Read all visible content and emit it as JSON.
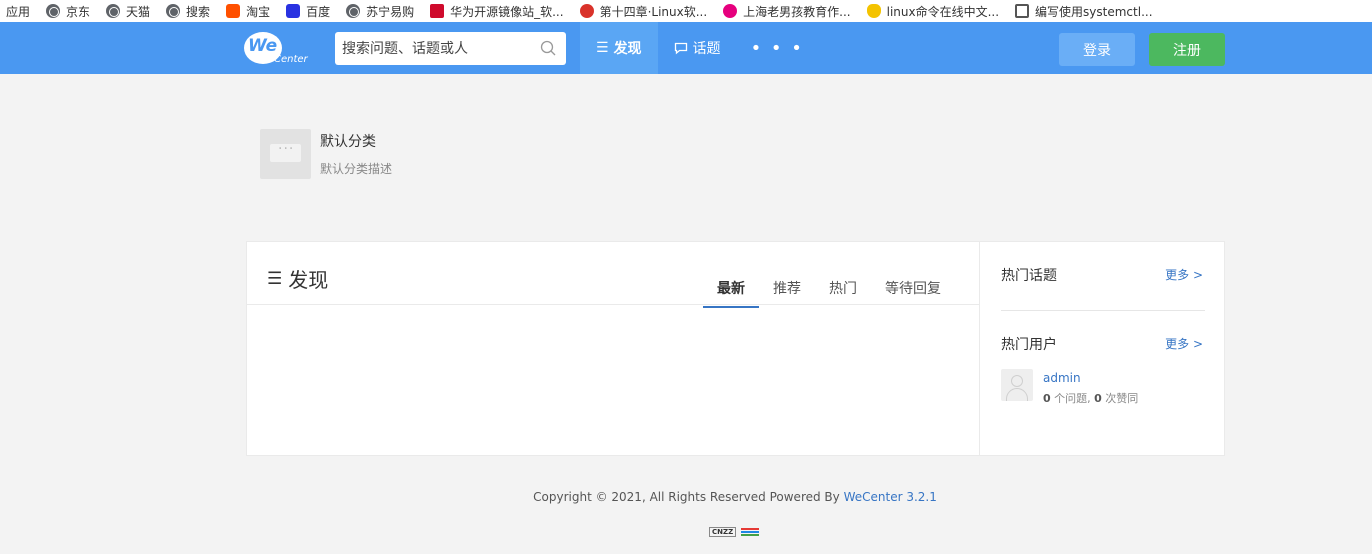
{
  "bookmarks": [
    {
      "label": "应用",
      "icon": "apps"
    },
    {
      "label": "京东",
      "icon": "globe-icon"
    },
    {
      "label": "天猫",
      "icon": "globe-icon"
    },
    {
      "label": "搜索",
      "icon": "globe-icon"
    },
    {
      "label": "淘宝",
      "icon": "taobao-icon"
    },
    {
      "label": "百度",
      "icon": "baidu-icon"
    },
    {
      "label": "苏宁易购",
      "icon": "globe-icon"
    },
    {
      "label": "华为开源镜像站_软...",
      "icon": "huawei-icon"
    },
    {
      "label": "第十四章·Linux软...",
      "icon": "red-circle-icon"
    },
    {
      "label": "上海老男孩教育作...",
      "icon": "pink-circle-icon"
    },
    {
      "label": "linux命令在线中文...",
      "icon": "tux-icon"
    },
    {
      "label": "编写使用systemctl...",
      "icon": "pen-icon"
    }
  ],
  "header": {
    "logo_we": "We",
    "logo_center": "Center",
    "search_placeholder": "搜索问题、话题或人",
    "nav": [
      {
        "label": "发现",
        "icon": "list-icon",
        "active": true
      },
      {
        "label": "话题",
        "icon": "chat-icon",
        "active": false
      }
    ],
    "more": "• • •",
    "login": "登录",
    "register": "注册",
    "colors": {
      "bar": "#4a98f1",
      "register": "#4cb85f"
    }
  },
  "category": {
    "title": "默认分类",
    "description": "默认分类描述"
  },
  "main": {
    "title": "发现",
    "tabs": [
      {
        "label": "最新",
        "active": true
      },
      {
        "label": "推荐",
        "active": false
      },
      {
        "label": "热门",
        "active": false
      },
      {
        "label": "等待回复",
        "active": false
      }
    ]
  },
  "sidebar": {
    "hot_topics": "热门话题",
    "hot_topics_more": "更多 >",
    "hot_users": "热门用户",
    "hot_users_more": "更多 >",
    "user": {
      "name": "admin",
      "questions": "0",
      "questions_label": " 个问题, ",
      "likes": "0",
      "likes_label": " 次赞同"
    }
  },
  "footer": {
    "copyright": "Copyright © 2021, All Rights Reserved Powered By ",
    "link": "WeCenter 3.2.1",
    "badge": "CNZZ"
  }
}
